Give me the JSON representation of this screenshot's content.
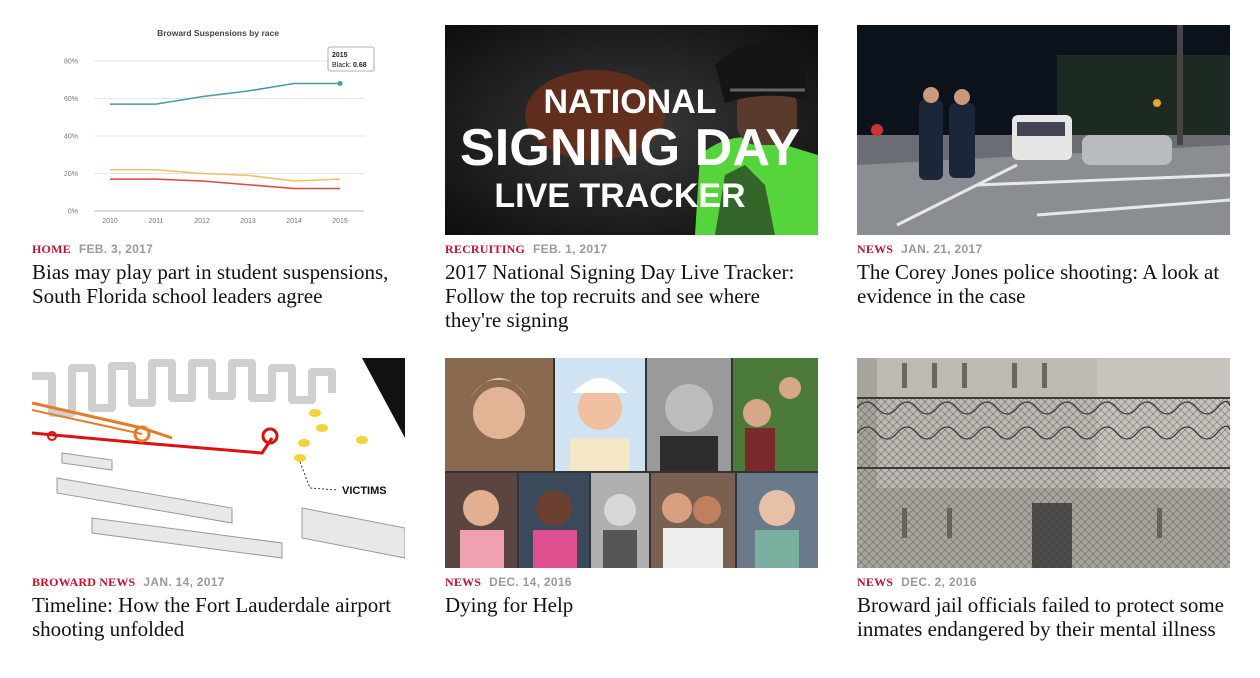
{
  "stories": [
    {
      "kicker": "HOME",
      "date": "FEB. 3, 2017",
      "headline": "Bias may play part in student suspensions, South Florida school leaders agree"
    },
    {
      "kicker": "RECRUITING",
      "date": "FEB. 1, 2017",
      "headline": "2017 National Signing Day Live Tracker: Follow the top recruits and see where they're signing",
      "image_text": {
        "line1": "NATIONAL",
        "line2": "SIGNING DAY",
        "line3": "LIVE TRACKER"
      }
    },
    {
      "kicker": "NEWS",
      "date": "JAN. 21, 2017",
      "headline": "The Corey Jones police shooting: A look at evidence in the case"
    },
    {
      "kicker": "BROWARD NEWS",
      "date": "JAN. 14, 2017",
      "headline": "Timeline: How the Fort Lauderdale airport shooting unfolded",
      "image_text": {
        "label": "VICTIMS"
      }
    },
    {
      "kicker": "NEWS",
      "date": "DEC. 14, 2016",
      "headline": "Dying for Help"
    },
    {
      "kicker": "NEWS",
      "date": "DEC. 2, 2016",
      "headline": "Broward jail officials failed to protect some inmates endangered by their mental illness"
    }
  ],
  "chart_data": {
    "type": "line",
    "title": "Broward Suspensions by race",
    "x": [
      2010,
      2011,
      2012,
      2013,
      2014,
      2015
    ],
    "ylim": [
      0,
      80
    ],
    "yticks": [
      "0%",
      "20%",
      "40%",
      "60%",
      "80%"
    ],
    "xticks": [
      "2010",
      "2011",
      "2012",
      "2013",
      "2014",
      "2015"
    ],
    "series": [
      {
        "color": "#4a9aa5",
        "values": [
          0.57,
          0.57,
          0.61,
          0.64,
          0.68,
          0.68
        ]
      },
      {
        "color": "#f0c060",
        "values": [
          0.22,
          0.22,
          0.2,
          0.19,
          0.16,
          0.17
        ]
      },
      {
        "color": "#e0483a",
        "values": [
          0.17,
          0.17,
          0.16,
          0.14,
          0.12,
          0.12
        ]
      }
    ],
    "tooltip": {
      "year": "2015",
      "label": "Black:",
      "value": "0.68"
    },
    "grid": true
  },
  "colors": {
    "kicker": "#c8102e",
    "date": "#9a9a9a",
    "headline": "#111111"
  }
}
